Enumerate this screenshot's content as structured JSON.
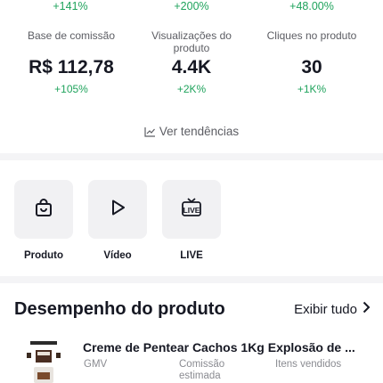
{
  "top_deltas": [
    "+141%",
    "+200%",
    "+48.00%"
  ],
  "metrics": [
    {
      "label": "Base de comissão",
      "value": "R$ 112,78",
      "change": "+105%"
    },
    {
      "label": "Visualizações do produto",
      "value": "4.4K",
      "change": "+2K%"
    },
    {
      "label": "Cliques no produto",
      "value": "30",
      "change": "+1K%"
    }
  ],
  "trend_link": "Ver tendências",
  "tiles": [
    {
      "label": "Produto",
      "icon": "bag-icon"
    },
    {
      "label": "Vídeo",
      "icon": "play-icon"
    },
    {
      "label": "LIVE",
      "icon": "live-icon"
    }
  ],
  "live_badge": "LIVE",
  "performance": {
    "title": "Desempenho do produto",
    "see_all": "Exibir tudo",
    "product": {
      "name": "Creme de Pentear Cachos 1Kg Explosão de ...",
      "col_gmv": "GMV",
      "col_commission": "Comissão estimada",
      "col_items": "Itens vendidos"
    }
  },
  "colors": {
    "positive": "#1fa35c",
    "tile_bg": "#f1f1f3",
    "divider": "#f4f4f6"
  }
}
